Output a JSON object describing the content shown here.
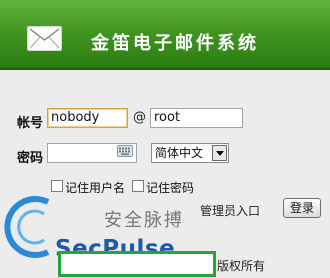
{
  "header": {
    "title": "金笛电子邮件系统",
    "logo_icon": "envelope-icon",
    "colors": {
      "gradient_top": "#64b33c",
      "gradient_bottom": "#2c7c12"
    }
  },
  "form": {
    "account_label": "帐号",
    "username_value": "nobody",
    "at_sign": "@",
    "domain_value": "root",
    "password_label": "密码",
    "password_value": "",
    "keyboard_icon": "keyboard-icon",
    "language_selected": "简体中文",
    "remember_user_label": "记住用户名",
    "remember_password_label": "记住密码",
    "admin_link": "管理员入口",
    "login_button": "登录"
  },
  "watermark": {
    "cn_text": "安全脉搏",
    "en_text": "SecPulse"
  },
  "footer": {
    "copyright_suffix": "版权所有"
  }
}
